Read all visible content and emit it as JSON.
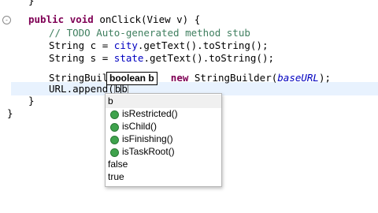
{
  "editor": {
    "lines": {
      "l0": "}",
      "l1_kw1": "public",
      "l1_kw2": "void",
      "l1_rest": " onClick(View v) {",
      "l2_comment": "// TODO Auto-generated method stub",
      "l3_a": "String c = ",
      "l3_field": "city",
      "l3_b": ".getText().toString();",
      "l4_a": "String s = ",
      "l4_field": "state",
      "l4_b": ".getText().toString();",
      "l5_a": "StringBuild",
      "l5_kw": "new",
      "l5_b": " StringBuilder(",
      "l5_param": "baseURL",
      "l5_c": ");",
      "l6_a": "URL.append(",
      "l6_typed": "b",
      "l6_b": "b",
      "l7": "}",
      "l8": "}"
    },
    "fold_markers": [
      "-",
      "-"
    ]
  },
  "tooltip": {
    "text": "boolean b"
  },
  "autocomplete": {
    "items": [
      {
        "label": "b",
        "icon": "none"
      },
      {
        "label": "isRestricted()",
        "icon": "method-public-icon"
      },
      {
        "label": "isChild()",
        "icon": "method-public-icon"
      },
      {
        "label": "isFinishing()",
        "icon": "method-public-icon"
      },
      {
        "label": "isTaskRoot()",
        "icon": "method-public-icon"
      },
      {
        "label": "false",
        "icon": "none"
      },
      {
        "label": "true",
        "icon": "none"
      }
    ],
    "selected_index": 0
  }
}
